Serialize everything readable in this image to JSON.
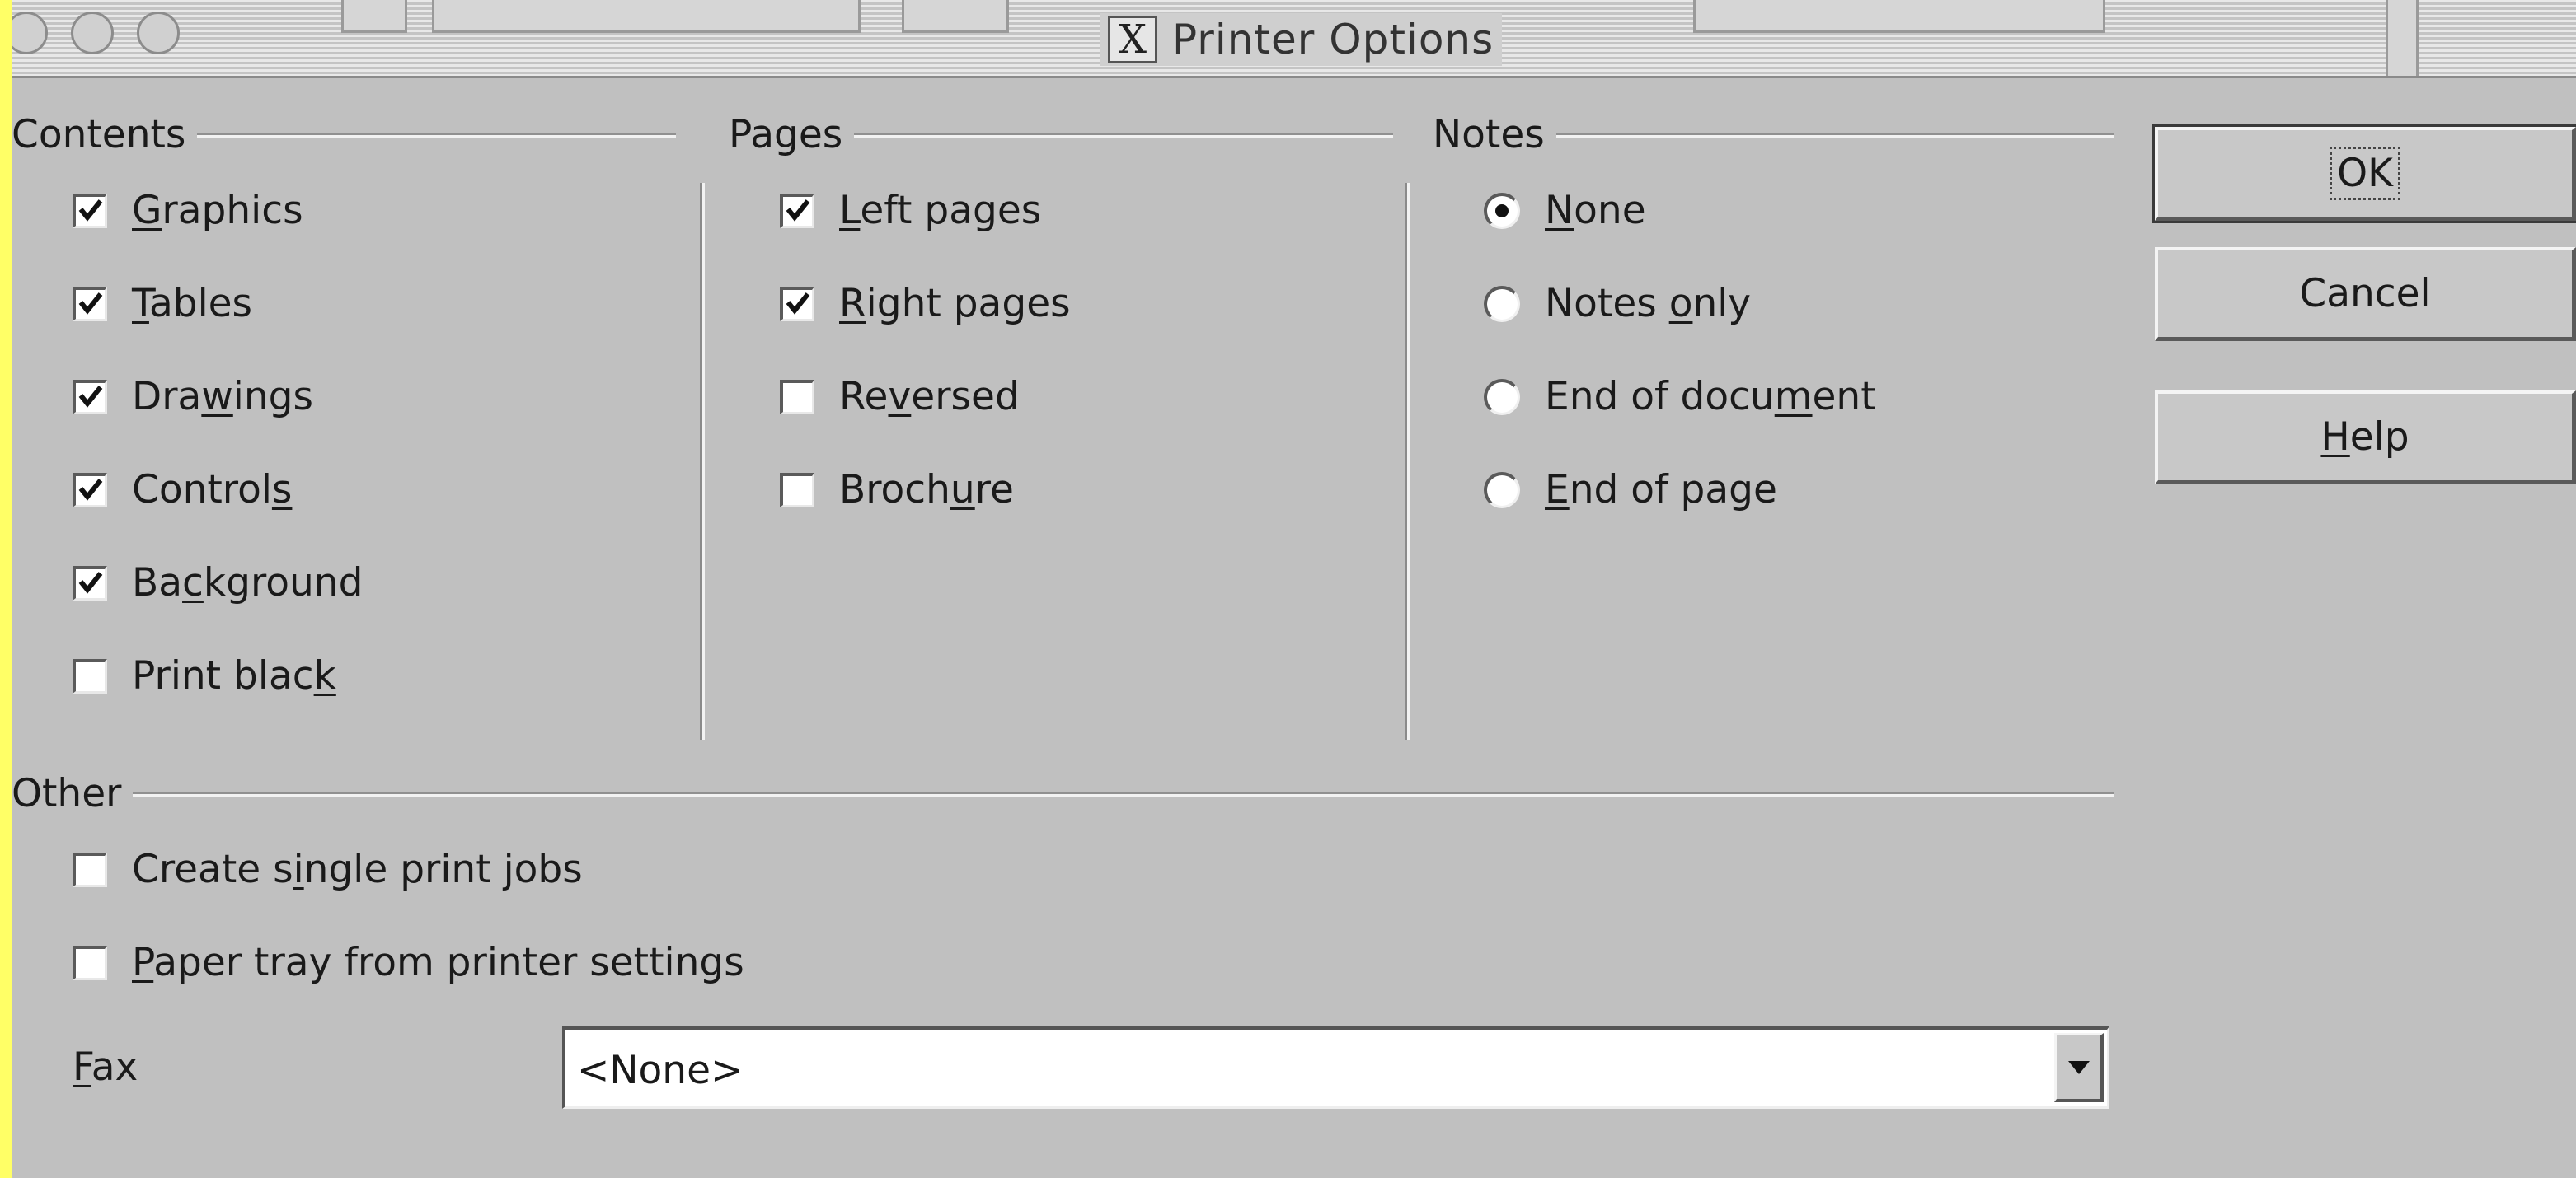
{
  "window": {
    "title": "Printer Options"
  },
  "sections": {
    "contents": {
      "label": "Contents",
      "items": [
        {
          "pre": "",
          "u": "G",
          "post": "raphics",
          "checked": true
        },
        {
          "pre": "",
          "u": "T",
          "post": "ables",
          "checked": true
        },
        {
          "pre": "Dra",
          "u": "w",
          "post": "ings",
          "checked": true
        },
        {
          "pre": "Control",
          "u": "s",
          "post": "",
          "checked": true
        },
        {
          "pre": "Ba",
          "u": "c",
          "post": "kground",
          "checked": true
        },
        {
          "pre": "Print blac",
          "u": "k",
          "post": "",
          "checked": false
        }
      ]
    },
    "pages": {
      "label": "Pages",
      "items": [
        {
          "pre": "",
          "u": "L",
          "post": "eft pages",
          "checked": true
        },
        {
          "pre": "",
          "u": "R",
          "post": "ight pages",
          "checked": true
        },
        {
          "pre": "Re",
          "u": "v",
          "post": "ersed",
          "checked": false
        },
        {
          "pre": "Broch",
          "u": "u",
          "post": "re",
          "checked": false
        }
      ]
    },
    "notes": {
      "label": "Notes",
      "items": [
        {
          "pre": "",
          "u": "N",
          "post": "one",
          "selected": true
        },
        {
          "pre": "Notes ",
          "u": "o",
          "post": "nly",
          "selected": false
        },
        {
          "pre": "End of docu",
          "u": "m",
          "post": "ent",
          "selected": false
        },
        {
          "pre": "",
          "u": "E",
          "post": "nd of page",
          "selected": false
        }
      ]
    },
    "other": {
      "label": "Other",
      "items": [
        {
          "pre": "Create s",
          "u": "i",
          "post": "ngle print jobs",
          "checked": false
        },
        {
          "pre": "",
          "u": "P",
          "post": "aper tray from printer settings",
          "checked": false
        }
      ],
      "fax": {
        "pre": "",
        "u": "F",
        "post": "ax",
        "value": "<None>"
      }
    }
  },
  "buttons": {
    "ok": "OK",
    "cancel": "Cancel",
    "help": {
      "pre": "",
      "u": "H",
      "post": "elp"
    }
  }
}
